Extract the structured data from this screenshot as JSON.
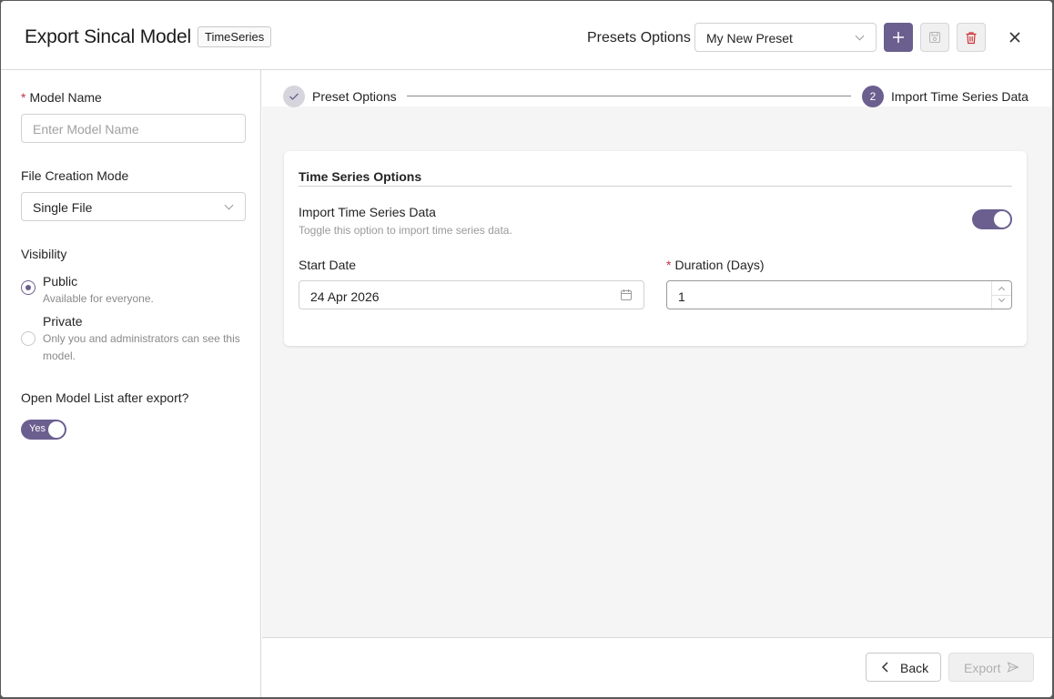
{
  "header": {
    "title": "Export Sincal Model",
    "tag": "TimeSeries",
    "presets_label": "Presets Options",
    "preset_value": "My New Preset"
  },
  "left": {
    "model_name_label": "Model Name",
    "model_name_placeholder": "Enter Model Name",
    "file_mode_label": "File Creation Mode",
    "file_mode_value": "Single File",
    "visibility_label": "Visibility",
    "visibility_options": [
      {
        "title": "Public",
        "desc": "Available for everyone.",
        "checked": true
      },
      {
        "title": "Private",
        "desc": "Only you and administrators can see this model.",
        "checked": false
      }
    ],
    "open_list_label": "Open Model List after export?",
    "open_list_toggle": "Yes"
  },
  "steps": [
    {
      "label": "Preset Options",
      "state": "done"
    },
    {
      "number": "2",
      "label": "Import Time Series Data",
      "state": "active"
    }
  ],
  "card": {
    "title": "Time Series Options",
    "import_label": "Import Time Series Data",
    "import_help": "Toggle this option to import time series data.",
    "import_on": true,
    "start_date_label": "Start Date",
    "start_date_value": "24 Apr 2026",
    "duration_label": "Duration (Days)",
    "duration_value": "1"
  },
  "footer": {
    "back_label": "Back",
    "export_label": "Export"
  },
  "colors": {
    "accent": "#6b5f8f",
    "required": "#c4314b",
    "delete": "#d13438"
  }
}
